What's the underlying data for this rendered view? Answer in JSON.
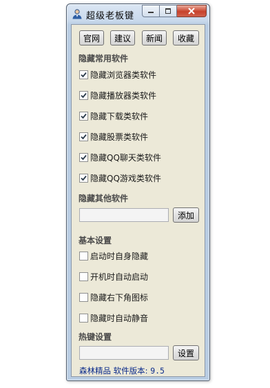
{
  "window": {
    "title": "超级老板键",
    "icon": "user-icon",
    "controls": {
      "minimize": "minimize-icon",
      "maximize": "maximize-icon",
      "close": "close-icon"
    }
  },
  "toolbar": {
    "buttons": [
      {
        "label": "官网"
      },
      {
        "label": "建议"
      },
      {
        "label": "新闻"
      },
      {
        "label": "收藏"
      }
    ]
  },
  "hide_common": {
    "heading": "隐藏常用软件",
    "items": [
      {
        "label": "隐藏浏览器类软件",
        "checked": true
      },
      {
        "label": "隐藏播放器类软件",
        "checked": true
      },
      {
        "label": "隐藏下载类软件",
        "checked": true
      },
      {
        "label": "隐藏股票类软件",
        "checked": true
      },
      {
        "label": "隐藏QQ聊天类软件",
        "checked": true
      },
      {
        "label": "隐藏QQ游戏类软件",
        "checked": true
      }
    ]
  },
  "hide_other": {
    "heading": "隐藏其他软件",
    "input_value": "",
    "add_label": "添加"
  },
  "basic": {
    "heading": "基本设置",
    "items": [
      {
        "label": "启动时自身隐藏",
        "checked": false
      },
      {
        "label": "开机时自动启动",
        "checked": false
      },
      {
        "label": "隐藏右下角图标",
        "checked": false
      },
      {
        "label": "隐藏时自动静音",
        "checked": false
      }
    ]
  },
  "hotkey": {
    "heading": "热键设置",
    "input_value": "",
    "set_label": "设置"
  },
  "status": {
    "brand": "森林精品",
    "version_label": "软件版本:",
    "version": "9.5"
  },
  "colors": {
    "status_text": "#0a2a8a",
    "close_button": "#c7422c",
    "client_bg": "#ece9d8"
  }
}
